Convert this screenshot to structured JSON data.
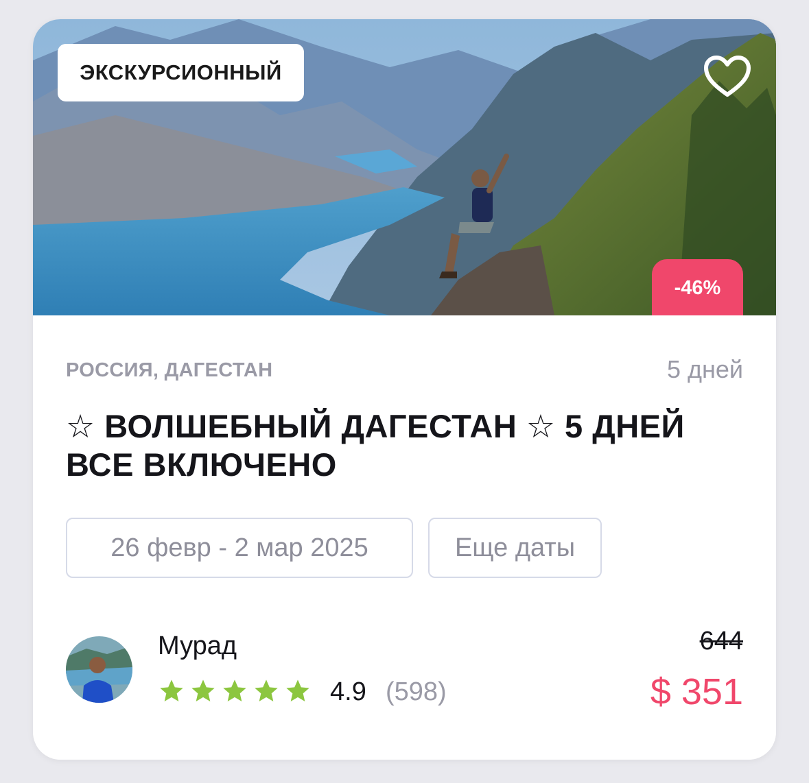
{
  "card": {
    "type_badge": "ЭКСКУРСИОННЫЙ",
    "discount": "-46%",
    "favorite_icon": "heart-outline-icon",
    "location": "РОССИЯ, ДАГЕСТАН",
    "duration": "5 дней",
    "title": "☆  ВОЛШЕБНЫЙ ДАГЕСТАН  ☆ 5 ДНЕЙ ВСЕ ВКЛЮЧЕНО",
    "dates_chip": "26 февр - 2 мар 2025",
    "more_dates_chip": "Еще даты",
    "guide": {
      "name": "Мурад",
      "rating": "4.9",
      "reviews": "(598)",
      "stars": 5,
      "star_color": "#8cc63f"
    },
    "old_price": "644",
    "price": "$ 351",
    "accent_color": "#f0476b"
  }
}
